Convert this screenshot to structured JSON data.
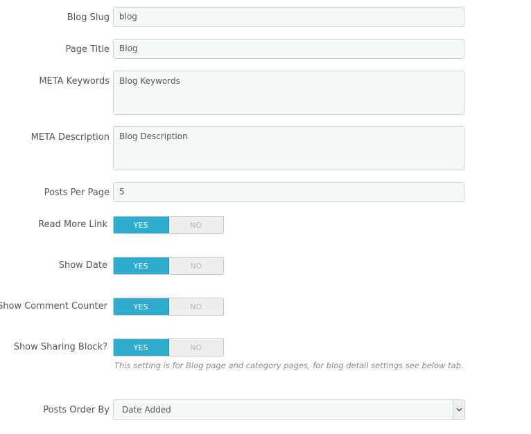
{
  "fields": {
    "blog_slug": {
      "label": "Blog Slug",
      "value": "blog"
    },
    "page_title": {
      "label": "Page Title",
      "value": "Blog"
    },
    "meta_keywords": {
      "label": "META Keywords",
      "value": "Blog Keywords"
    },
    "meta_description": {
      "label": "META Description",
      "value": "Blog Description"
    },
    "posts_per_page": {
      "label": "Posts Per Page",
      "value": "5"
    },
    "read_more_link": {
      "label": "Read More Link",
      "yes": "YES",
      "no": "NO",
      "selected": "YES"
    },
    "show_date": {
      "label": "Show Date",
      "yes": "YES",
      "no": "NO",
      "selected": "YES"
    },
    "show_comment_counter": {
      "label": "Show Comment Counter",
      "yes": "YES",
      "no": "NO",
      "selected": "YES"
    },
    "show_sharing_block": {
      "label": "Show Sharing Block?",
      "yes": "YES",
      "no": "NO",
      "selected": "YES",
      "help": "This setting is for Blog page and category pages, for blog detail settings see below tab."
    },
    "posts_order_by": {
      "label": "Posts Order By",
      "value": "Date Added",
      "icon": "chevron-down-icon"
    }
  },
  "colors": {
    "switch_active": "#2eacce",
    "input_background": "#f5f8f9",
    "input_border": "#c7d6db"
  }
}
